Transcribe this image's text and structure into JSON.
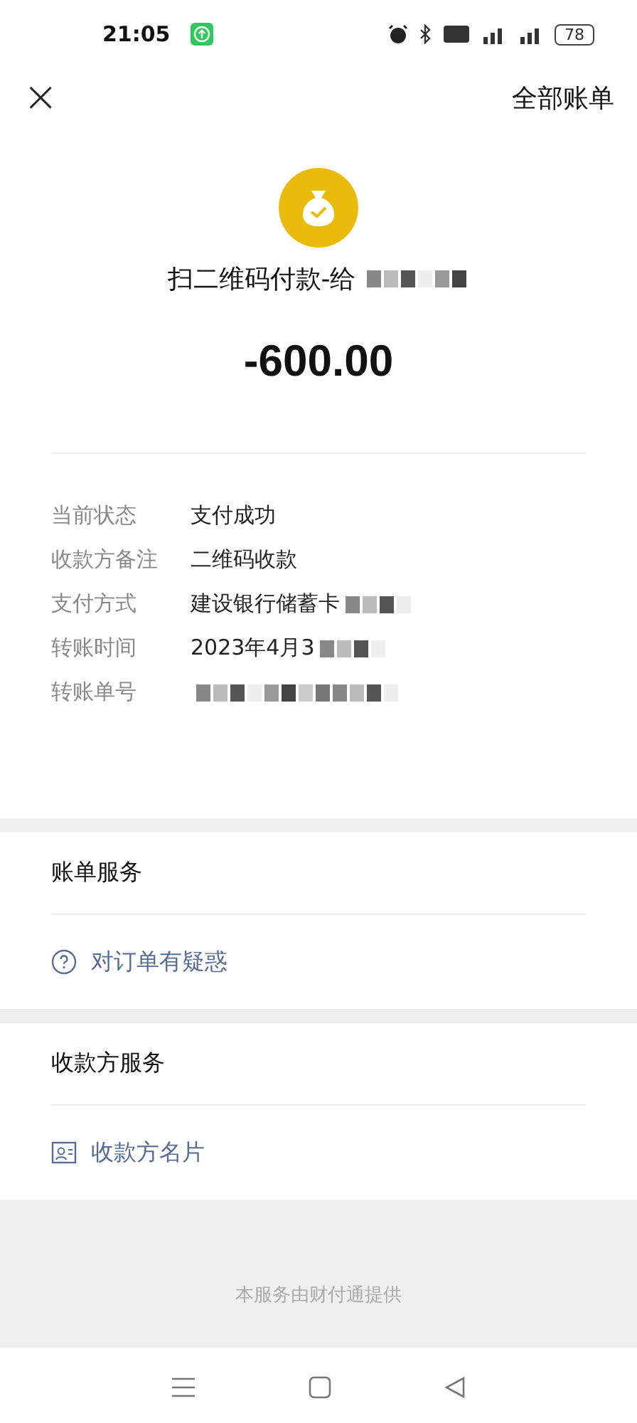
{
  "status_bar": {
    "time": "21:05",
    "battery": "78"
  },
  "header": {
    "close": "×",
    "all_bills": "全部账单"
  },
  "summary": {
    "title": "扫二维码付款-给",
    "amount": "-600.00"
  },
  "details": [
    {
      "label": "当前状态",
      "value": "支付成功",
      "redacted": false
    },
    {
      "label": "收款方备注",
      "value": "二维码收款",
      "redacted": false
    },
    {
      "label": "支付方式",
      "value": "建设银行储蓄卡",
      "redacted": true
    },
    {
      "label": "转账时间",
      "value": "2023年4月3",
      "redacted": true
    },
    {
      "label": "转账单号",
      "redacted": true
    }
  ],
  "sections": [
    {
      "title": "账单服务",
      "items": [
        {
          "kind": "help",
          "label": "对订单有疑惑"
        }
      ]
    },
    {
      "title": "收款方服务",
      "items": [
        {
          "kind": "card",
          "label": "收款方名片"
        }
      ]
    }
  ],
  "footer": "本服务由财付通提供"
}
